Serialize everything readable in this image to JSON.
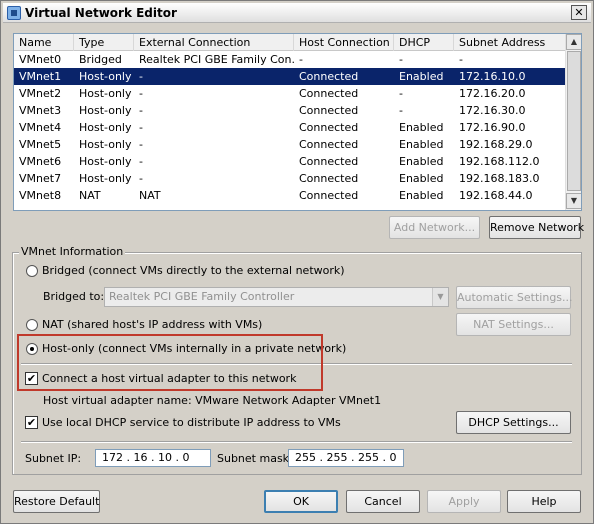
{
  "window": {
    "title": "Virtual Network Editor",
    "close_glyph": "✕"
  },
  "table": {
    "columns": [
      "Name",
      "Type",
      "External Connection",
      "Host Connection",
      "DHCP",
      "Subnet Address"
    ],
    "rows": [
      [
        "VMnet0",
        "Bridged",
        "Realtek PCI GBE Family Con...",
        "-",
        "-",
        "-"
      ],
      [
        "VMnet1",
        "Host-only",
        "-",
        "Connected",
        "Enabled",
        "172.16.10.0"
      ],
      [
        "VMnet2",
        "Host-only",
        "-",
        "Connected",
        "-",
        "172.16.20.0"
      ],
      [
        "VMnet3",
        "Host-only",
        "-",
        "Connected",
        "-",
        "172.16.30.0"
      ],
      [
        "VMnet4",
        "Host-only",
        "-",
        "Connected",
        "Enabled",
        "172.16.90.0"
      ],
      [
        "VMnet5",
        "Host-only",
        "-",
        "Connected",
        "Enabled",
        "192.168.29.0"
      ],
      [
        "VMnet6",
        "Host-only",
        "-",
        "Connected",
        "Enabled",
        "192.168.112.0"
      ],
      [
        "VMnet7",
        "Host-only",
        "-",
        "Connected",
        "Enabled",
        "192.168.183.0"
      ],
      [
        "VMnet8",
        "NAT",
        "NAT",
        "Connected",
        "Enabled",
        "192.168.44.0"
      ]
    ],
    "selected_row": "VMnet1"
  },
  "buttons": {
    "add_network": "Add Network...",
    "remove_network": "Remove Network",
    "automatic_settings": "Automatic Settings...",
    "nat_settings": "NAT Settings...",
    "dhcp_settings": "DHCP Settings...",
    "restore_default": "Restore Default",
    "ok": "OK",
    "cancel": "Cancel",
    "apply": "Apply",
    "help": "Help"
  },
  "vmnet_info": {
    "group_label": "VMnet Information",
    "bridged_label": "Bridged (connect VMs directly to the external network)",
    "bridged_to_label": "Bridged to:",
    "bridged_to_value": "Realtek PCI GBE Family Controller",
    "nat_label": "NAT (shared host's IP address with VMs)",
    "host_only_label": "Host-only (connect VMs internally in a private network)",
    "connect_adapter_label": "Connect a host virtual adapter to this network",
    "adapter_name_text": "Host virtual adapter name: VMware Network Adapter VMnet1",
    "dhcp_label": "Use local DHCP service to distribute IP address to VMs",
    "subnet_ip_label": "Subnet IP:",
    "subnet_ip_value": "172 . 16 . 10 . 0",
    "subnet_mask_label": "Subnet mask:",
    "subnet_mask_value": "255 . 255 . 255 . 0",
    "selected_mode": "host-only",
    "connect_adapter_checked": true,
    "dhcp_checked": true
  },
  "glyphs": {
    "check": "✔",
    "arrow_up": "▲",
    "arrow_down": "▼"
  },
  "colors": {
    "selection": "#0a246a",
    "highlight_box": "#c0392b"
  }
}
